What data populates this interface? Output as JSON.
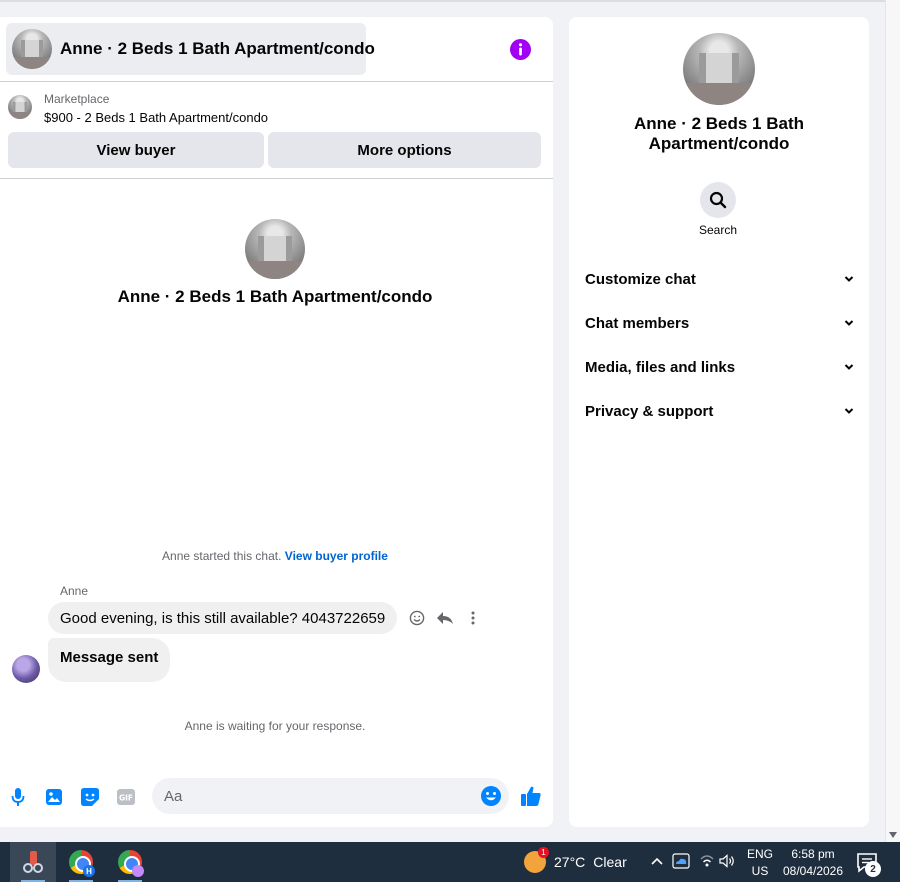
{
  "chat": {
    "title": "Anne · 2 Beds 1 Bath Apartment/condo",
    "marketplace_label": "Marketplace",
    "listing": "$900 - 2 Beds 1 Bath Apartment/condo",
    "view_buyer_label": "View buyer",
    "more_options_label": "More options",
    "center_title": "Anne · 2 Beds 1 Bath Apartment/condo",
    "started_text": "Anne started this chat.",
    "view_buyer_profile": "View buyer profile",
    "sender_name": "Anne",
    "messages": [
      {
        "text": "Good evening, is this still available? 4043722659"
      },
      {
        "text": "Message sent"
      }
    ],
    "waiting_text": "Anne is waiting for your response.",
    "composer_placeholder": "Aa"
  },
  "side": {
    "title": "Anne · 2 Beds 1 Bath Apartment/condo",
    "search_label": "Search",
    "items": [
      {
        "label": "Customize chat"
      },
      {
        "label": "Chat members"
      },
      {
        "label": "Media, files and links"
      },
      {
        "label": "Privacy & support"
      }
    ]
  },
  "taskbar": {
    "chrome_badge_1": "H",
    "weather_badge": "1",
    "temperature": "27°C",
    "condition": "Clear",
    "lang_1": "ENG",
    "lang_2": "US",
    "time": "6:58 pm",
    "date": "08/04/2026",
    "notification_count": "2"
  },
  "colors": {
    "messenger_blue": "#0084ff",
    "info_purple": "#a100f2",
    "link_blue": "#0064d1"
  }
}
